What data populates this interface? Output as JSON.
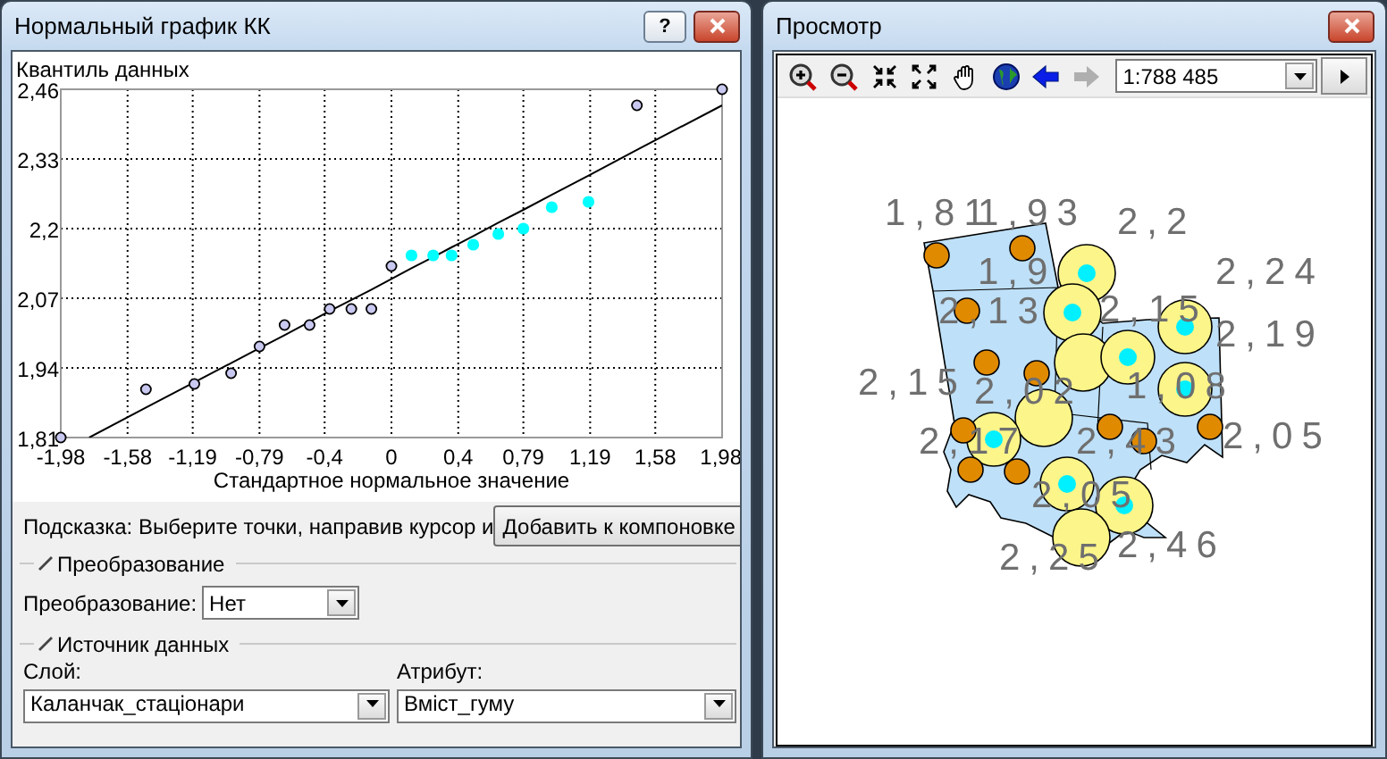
{
  "qq_window": {
    "title": "Нормальный график КК",
    "help_button": "?",
    "chart_data": {
      "type": "scatter",
      "ylabel": "Квантиль данных",
      "xlabel": "Стандартное нормальное значение",
      "x": [
        -1.98,
        -1.81,
        -1.47,
        -1.18,
        -0.96,
        -0.79,
        -0.64,
        -0.49,
        -0.37,
        -0.24,
        -0.12,
        0,
        0.12,
        0.25,
        0.36,
        0.49,
        0.64,
        0.79,
        0.96,
        1.18,
        1.47,
        1.98
      ],
      "series": [
        {
          "color": "#c8c8f0",
          "values": [
            1.81,
            null,
            1.9,
            1.91,
            1.93,
            1.98,
            2.02,
            2.02,
            2.05,
            2.05,
            2.05,
            2.13,
            null,
            null,
            null,
            null,
            null,
            null,
            null,
            null,
            2.43,
            2.46
          ]
        },
        {
          "color": "#00ffff",
          "values": [
            null,
            null,
            null,
            null,
            null,
            null,
            null,
            null,
            null,
            null,
            null,
            null,
            2.15,
            2.15,
            2.15,
            2.17,
            2.19,
            2.2,
            2.24,
            2.25,
            null,
            null
          ]
        },
        {
          "type": "line",
          "color": "#000000",
          "values": [
            null,
            1.81,
            1.866,
            1.913,
            1.949,
            1.977,
            2.001,
            2.026,
            2.046,
            2.067,
            2.086,
            2.106,
            2.126,
            2.147,
            2.165,
            2.186,
            2.211,
            2.235,
            2.263,
            2.299,
            2.347,
            2.43
          ]
        }
      ],
      "xlim": [
        -1.98,
        1.98
      ],
      "ylim": [
        1.81,
        2.46
      ],
      "xticks": [
        {
          "value": -1.98,
          "label": "-1,98"
        },
        {
          "value": -1.58,
          "label": "-1,58"
        },
        {
          "value": -1.19,
          "label": "-1,19"
        },
        {
          "value": -0.79,
          "label": "-0,79"
        },
        {
          "value": -0.4,
          "label": "-0,4"
        },
        {
          "value": 0,
          "label": "0"
        },
        {
          "value": 0.4,
          "label": "0,4"
        },
        {
          "value": 0.79,
          "label": "0,79"
        },
        {
          "value": 1.19,
          "label": "1,19"
        },
        {
          "value": 1.58,
          "label": "1,58"
        },
        {
          "value": 1.98,
          "label": "1,98"
        }
      ],
      "yticks": [
        {
          "value": 2.46,
          "label": "2,46"
        },
        {
          "value": 2.33,
          "label": "2,33"
        },
        {
          "value": 2.2,
          "label": "2,2"
        },
        {
          "value": 2.07,
          "label": "2,07"
        },
        {
          "value": 1.94,
          "label": "1,94"
        },
        {
          "value": 1.81,
          "label": "1,81"
        }
      ],
      "grid": true
    },
    "hint": "Подсказка:  Выберите точки, направив курсор и",
    "add_button": "Добавить к компоновке",
    "transformation_group": {
      "title": "Преобразование",
      "label": "Преобразование:",
      "value": "Нет"
    },
    "data_source_group": {
      "title": "Источник данных",
      "layer_label": "Слой:",
      "layer_value": "Каланчак_стаціонари",
      "attribute_label": "Атрибут:",
      "attribute_value": "Вміст_гуму"
    }
  },
  "preview_window": {
    "title": "Просмотр",
    "toolbar": [
      {
        "kind": "zoom-in",
        "disabled": false
      },
      {
        "kind": "zoom-out",
        "disabled": false
      },
      {
        "kind": "fixed-zoom-in",
        "disabled": false
      },
      {
        "kind": "fixed-zoom-out",
        "disabled": false
      },
      {
        "kind": "pan",
        "disabled": false
      },
      {
        "kind": "full-extent",
        "disabled": false
      },
      {
        "kind": "back",
        "disabled": false
      },
      {
        "kind": "forward",
        "disabled": true
      }
    ],
    "scale": "1:788 485",
    "map_labels": [
      "1,81",
      "1,93",
      "2,2",
      "2,24",
      "1,9",
      "2,13",
      "2,15",
      "2,19",
      "2,15",
      "2,02",
      "1,08",
      "2,17",
      "2,43",
      "2,05",
      "2,05",
      "2,46",
      "2,25"
    ]
  }
}
